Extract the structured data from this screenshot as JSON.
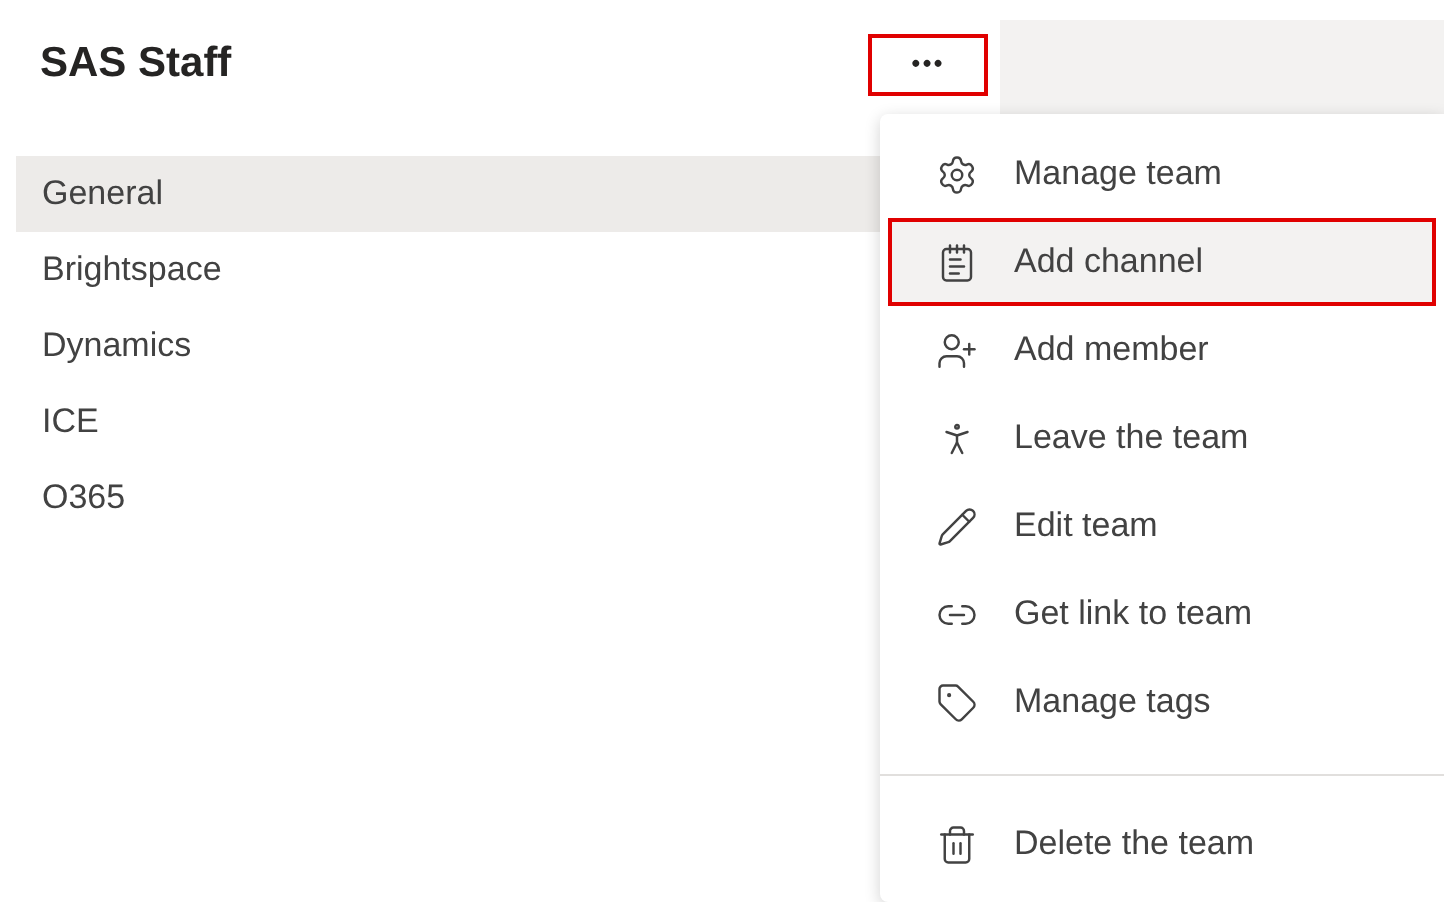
{
  "team": {
    "name": "SAS Staff",
    "more_button": {
      "label": "•••",
      "highlighted": true
    }
  },
  "channels": [
    {
      "name": "General",
      "selected": true
    },
    {
      "name": "Brightspace",
      "selected": false
    },
    {
      "name": "Dynamics",
      "selected": false
    },
    {
      "name": "ICE",
      "selected": false
    },
    {
      "name": "O365",
      "selected": false
    }
  ],
  "menu": [
    {
      "label": "Manage team",
      "highlighted": false,
      "separator_before": false
    },
    {
      "label": "Add channel",
      "highlighted": true,
      "separator_before": false
    },
    {
      "label": "Add member",
      "highlighted": false,
      "separator_before": false
    },
    {
      "label": "Leave the team",
      "highlighted": false,
      "separator_before": false
    },
    {
      "label": "Edit team",
      "highlighted": false,
      "separator_before": false
    },
    {
      "label": "Get link to team",
      "highlighted": false,
      "separator_before": false
    },
    {
      "label": "Manage tags",
      "highlighted": false,
      "separator_before": false
    },
    {
      "label": "Delete the team",
      "highlighted": false,
      "separator_before": true
    }
  ]
}
